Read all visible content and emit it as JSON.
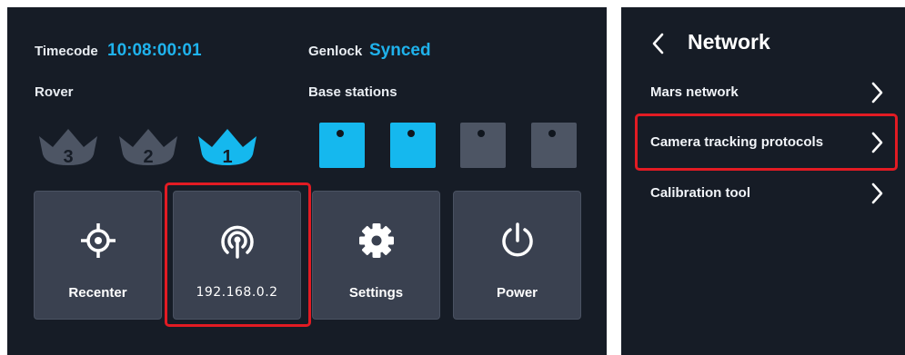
{
  "status": {
    "timecode_label": "Timecode",
    "timecode_value": "10:08:00:01",
    "genlock_label": "Genlock",
    "genlock_value": "Synced"
  },
  "rover": {
    "label": "Rover",
    "items": [
      {
        "number": "3",
        "active": false
      },
      {
        "number": "2",
        "active": false
      },
      {
        "number": "1",
        "active": true
      }
    ]
  },
  "base_stations": {
    "label": "Base stations",
    "items": [
      {
        "active": true
      },
      {
        "active": true
      },
      {
        "active": false
      },
      {
        "active": false
      }
    ]
  },
  "tiles": [
    {
      "label": "Recenter",
      "icon": "crosshair-icon"
    },
    {
      "label": "192.168.0.2",
      "icon": "wireless-icon"
    },
    {
      "label": "Settings",
      "icon": "gear-icon"
    },
    {
      "label": "Power",
      "icon": "power-icon"
    }
  ],
  "network": {
    "title": "Network",
    "items": [
      {
        "label": "Mars network"
      },
      {
        "label": "Camera tracking protocols"
      },
      {
        "label": "Calibration tool"
      }
    ]
  },
  "colors": {
    "accent": "#1fb2ec",
    "highlight": "#e21b23",
    "panel": "#161c26",
    "tile": "#3a4150",
    "inactive": "#4d5564"
  }
}
